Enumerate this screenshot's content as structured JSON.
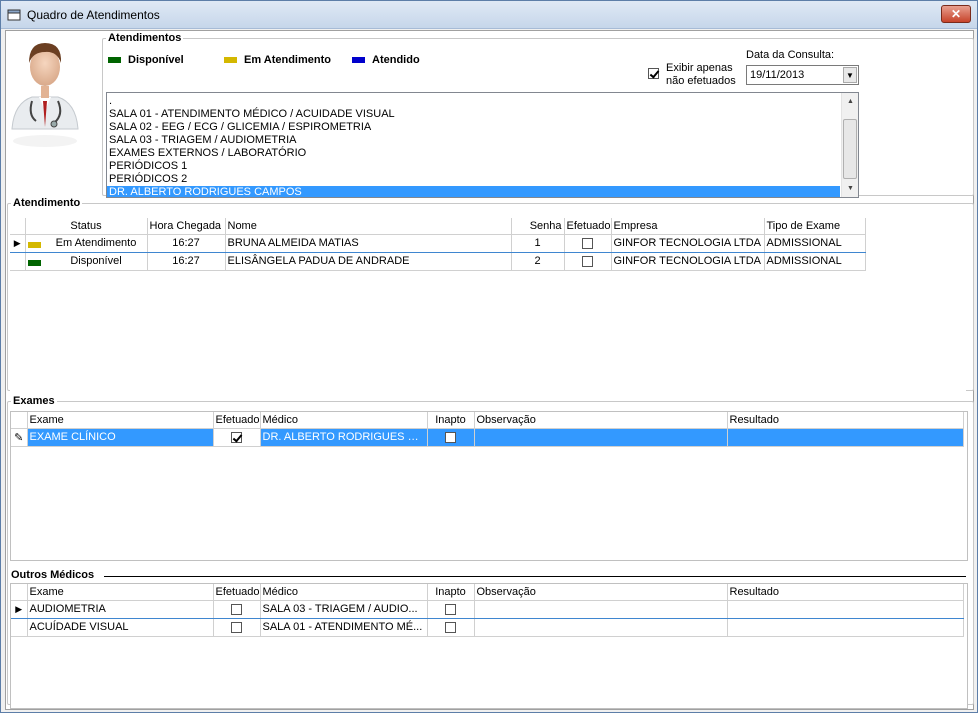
{
  "window": {
    "title": "Quadro de Atendimentos",
    "close_label": "✕"
  },
  "colors": {
    "disponivel": "#006400",
    "em_atendimento": "#d4b800",
    "atendido": "#0000cc",
    "selection": "#3399ff"
  },
  "atendimentos": {
    "title": "Atendimentos",
    "legend": {
      "disponivel": "Disponível",
      "em_atendimento": "Em Atendimento",
      "atendido": "Atendido"
    },
    "filter_label_1": "Exibir apenas",
    "filter_label_2": "não efetuados",
    "filter_checked": true,
    "date_label": "Data da Consulta:",
    "date_value": "19/11/2013",
    "rooms": [
      ".",
      "SALA 01 - ATENDIMENTO MÉDICO / ACUIDADE VISUAL",
      "SALA 02 - EEG / ECG / GLICEMIA / ESPIROMETRIA",
      "SALA 03 - TRIAGEM / AUDIOMETRIA",
      "EXAMES EXTERNOS / LABORATÓRIO",
      "PERIÓDICOS 1",
      "PERIÓDICOS 2",
      "DR. ALBERTO RODRIGUES CAMPOS"
    ]
  },
  "atendimento": {
    "title": "Atendimento",
    "columns": {
      "status": "Status",
      "hora": "Hora Chegada",
      "nome": "Nome",
      "senha": "Senha",
      "efetuado": "Efetuado",
      "empresa": "Empresa",
      "tipo": "Tipo de Exame"
    },
    "rows": [
      {
        "status": "Em Atendimento",
        "hora": "16:27",
        "nome": "BRUNA ALMEIDA MATIAS",
        "senha": "1",
        "empresa": "GINFOR TECNOLOGIA LTDA",
        "tipo": "ADMISSIONAL"
      },
      {
        "status": "Disponível",
        "hora": "16:27",
        "nome": "ELISÂNGELA PADUA DE ANDRADE",
        "senha": "2",
        "empresa": "GINFOR TECNOLOGIA LTDA",
        "tipo": "ADMISSIONAL"
      }
    ]
  },
  "exames": {
    "title": "Exames",
    "columns": {
      "exame": "Exame",
      "efetuado": "Efetuado",
      "medico": "Médico",
      "inapto": "Inapto",
      "obs": "Observação",
      "resultado": "Resultado"
    },
    "rows": [
      {
        "exame": "EXAME CLÍNICO",
        "medico": "DR. ALBERTO RODRIGUES C...",
        "obs": "",
        "resultado": ""
      }
    ]
  },
  "outros": {
    "title": "Outros Médicos",
    "columns": {
      "exame": "Exame",
      "efetuado": "Efetuado",
      "medico": "Médico",
      "inapto": "Inapto",
      "obs": "Observação",
      "resultado": "Resultado"
    },
    "rows": [
      {
        "exame": "AUDIOMETRIA",
        "medico": "SALA 03 - TRIAGEM / AUDIO...",
        "obs": "",
        "resultado": ""
      },
      {
        "exame": "ACUÍDADE VISUAL",
        "medico": "SALA 01 - ATENDIMENTO MÉ...",
        "obs": "",
        "resultado": ""
      }
    ]
  }
}
